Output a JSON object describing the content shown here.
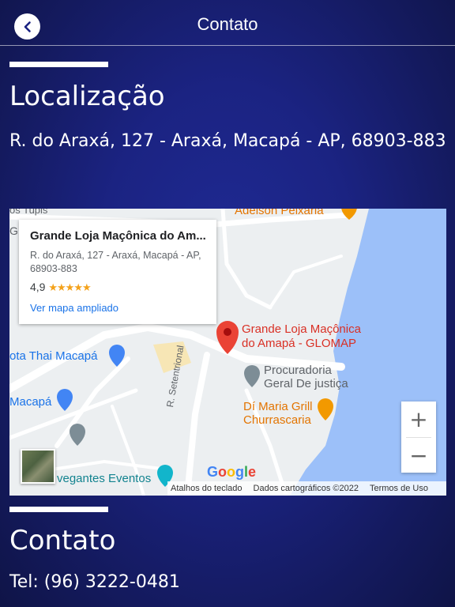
{
  "header": {
    "title": "Contato"
  },
  "location": {
    "heading": "Localização",
    "address": "R. do Araxá, 127 - Araxá, Macapá - AP, 68903-883"
  },
  "map": {
    "card": {
      "name": "Grande Loja Maçônica do Am...",
      "address": "R. do Araxá, 127 - Araxá, Macapá - AP, 68903-883",
      "rating": "4,9",
      "stars": "★★★★★",
      "link": "Ver mapa ampliado"
    },
    "labels": {
      "top_left": "os Tupis",
      "top_left_g": "G",
      "adelson": "Adelson Peixaria",
      "marker_line1": "Grande Loja Maçônica",
      "marker_line2": "do Amapá - GLOMAP",
      "thai": "ota Thai Macapá",
      "procuradoria1": "Procuradoria",
      "procuradoria2": "Geral De justiça",
      "macapa": "Macapá",
      "dimaria1": "Dí Maria Grill",
      "dimaria2": "Churrascaria",
      "street": "R. Setentrional",
      "eventos": "vegantes Eventos"
    },
    "zoom_in": "+",
    "zoom_out": "−",
    "google": "Google",
    "footer": {
      "shortcuts": "Atalhos do teclado",
      "data": "Dados cartográficos ©2022",
      "terms": "Termos de Uso"
    },
    "colors": {
      "water": "#9cc0f9",
      "marker": "#ea4335",
      "accent_orange": "#f29900",
      "poi_gray": "#7d8d96",
      "poi_blue": "#4285f4"
    }
  },
  "contact": {
    "heading": "Contato",
    "phone": "Tel: (96) 3222-0481"
  }
}
